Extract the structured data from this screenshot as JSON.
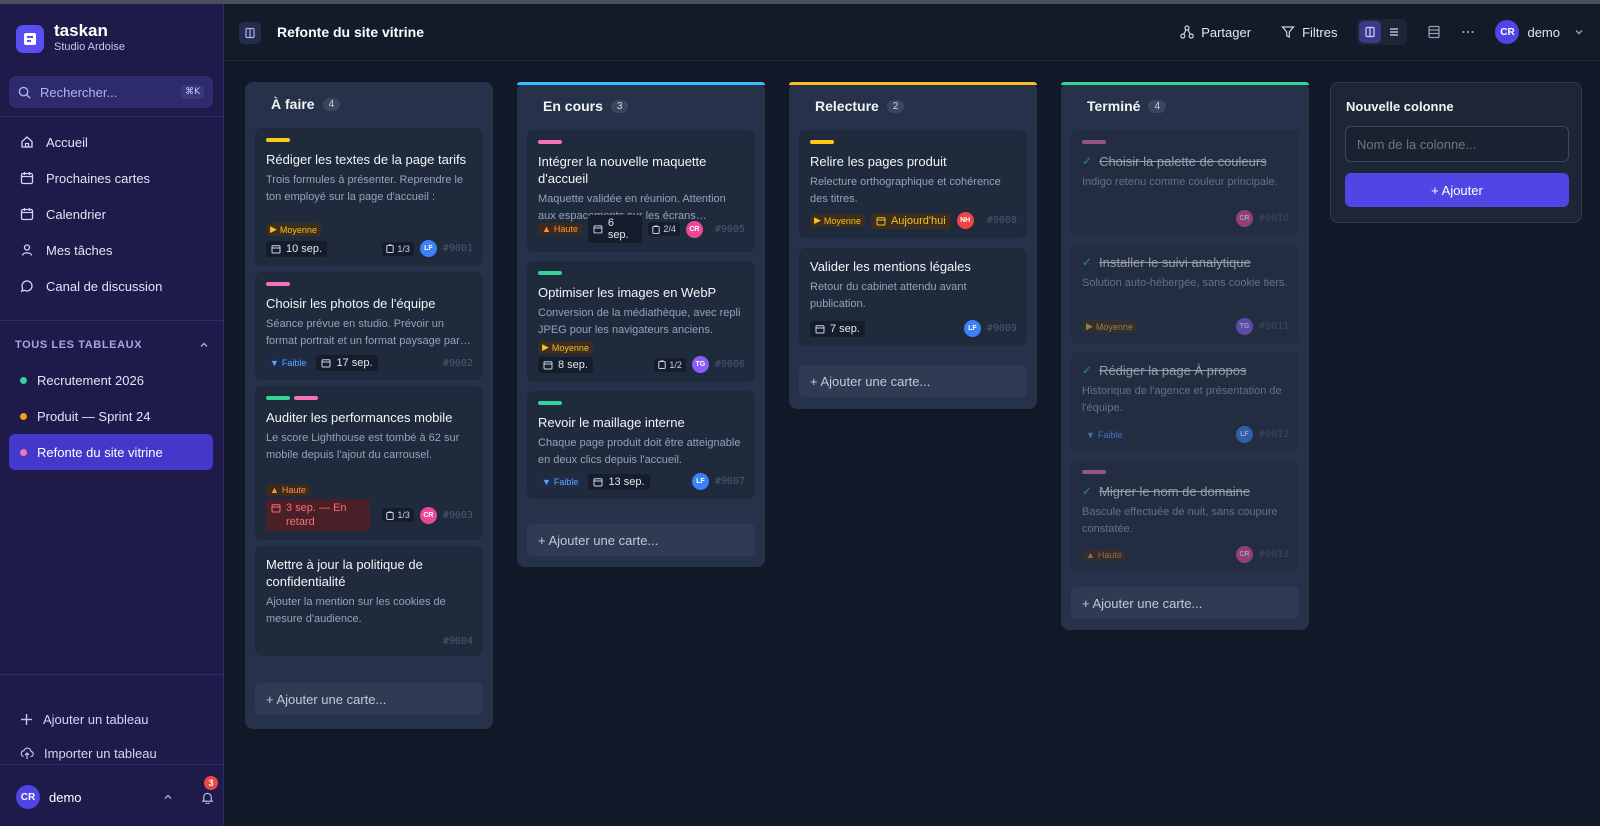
{
  "app": {
    "name": "taskan",
    "workspace": "Studio Ardoise"
  },
  "search": {
    "placeholder": "Rechercher...",
    "shortcut": "⌘K"
  },
  "nav": [
    {
      "label": "Accueil",
      "icon": "home-icon"
    },
    {
      "label": "Prochaines cartes",
      "icon": "calendar-icon"
    },
    {
      "label": "Calendrier",
      "icon": "calendar-icon"
    },
    {
      "label": "Mes tâches",
      "icon": "user-icon"
    },
    {
      "label": "Canal de discussion",
      "icon": "chat-icon"
    }
  ],
  "boards_section": {
    "title": "TOUS LES TABLEAUX"
  },
  "boards": [
    {
      "label": "Recrutement 2026",
      "color": "#34d399"
    },
    {
      "label": "Produit — Sprint 24",
      "color": "#f59e0b"
    },
    {
      "label": "Refonte du site vitrine",
      "color": "#f472b6"
    }
  ],
  "side_actions": {
    "add_board": "Ajouter un tableau",
    "import_board": "Importer un tableau"
  },
  "user": {
    "initials": "CR",
    "name": "demo",
    "notifications": "3"
  },
  "header": {
    "title": "Refonte du site vitrine",
    "share": "Partager",
    "filters": "Filtres",
    "user_initials": "CR",
    "user_name": "demo"
  },
  "columns": [
    {
      "title": "À faire",
      "count": "4",
      "accent": "",
      "add_card": "+ Ajouter une carte...",
      "cards": [
        {
          "labels": [
            "#facc15"
          ],
          "title": "Rédiger les textes de la page tarifs",
          "desc": "Trois formules à présenter. Reprendre le ton employé sur la page d'accueil : direct…",
          "priority": "Moyenne",
          "date": "10 sep.",
          "checklist": "1/3",
          "assignee": "LF",
          "id": "#9001"
        },
        {
          "labels": [
            "#f472b6"
          ],
          "title": "Choisir les photos de l'équipe",
          "desc": "Séance prévue en studio. Prévoir un format portrait et un format paysage par…",
          "priority": "Faible",
          "date": "17 sep.",
          "checklist": "",
          "assignee": "",
          "id": "#9002"
        },
        {
          "labels": [
            "#34d399",
            "#f472b6"
          ],
          "title": "Auditer les performances mobile",
          "desc": "Le score Lighthouse est tombé à 62 sur mobile depuis l'ajout du carrousel.",
          "priority": "Haute",
          "date": "3 sep. — En retard",
          "checklist": "1/3",
          "assignee": "CR",
          "id": "#9003"
        },
        {
          "labels": [],
          "title": "Mettre à jour la politique de confidentialité",
          "desc": "Ajouter la mention sur les cookies de mesure d'audience.",
          "priority": "",
          "date": "",
          "checklist": "",
          "assignee": "",
          "id": "#9004"
        }
      ]
    },
    {
      "title": "En cours",
      "count": "3",
      "accent": "#38bdf8",
      "add_card": "+ Ajouter une carte...",
      "cards": [
        {
          "labels": [
            "#f472b6"
          ],
          "title": "Intégrer la nouvelle maquette d'accueil",
          "desc": "Maquette validée en réunion. Attention aux espacements sur les écrans…",
          "priority": "Haute",
          "date": "6 sep.",
          "checklist": "2/4",
          "assignee": "CR",
          "id": "#9005"
        },
        {
          "labels": [
            "#34d399"
          ],
          "title": "Optimiser les images en WebP",
          "desc": "Conversion de la médiathèque, avec repli JPEG pour les navigateurs anciens.",
          "priority": "Moyenne",
          "date": "8 sep.",
          "checklist": "1/2",
          "assignee": "TG",
          "id": "#9006"
        },
        {
          "labels": [
            "#34d399"
          ],
          "title": "Revoir le maillage interne",
          "desc": "Chaque page produit doit être atteignable en deux clics depuis l'accueil.",
          "priority": "Faible",
          "date": "13 sep.",
          "checklist": "",
          "assignee": "LF",
          "id": "#9007"
        }
      ]
    },
    {
      "title": "Relecture",
      "count": "2",
      "accent": "#fbbf24",
      "add_card": "+ Ajouter une carte...",
      "cards": [
        {
          "labels": [
            "#facc15"
          ],
          "title": "Relire les pages produit",
          "desc": "Relecture orthographique et cohérence des titres.",
          "priority": "Moyenne",
          "date": "Aujourd'hui",
          "checklist": "",
          "assignee": "NH",
          "id": "#9008"
        },
        {
          "labels": [],
          "title": "Valider les mentions légales",
          "desc": "Retour du cabinet attendu avant publication.",
          "priority": "",
          "date": "7 sep.",
          "checklist": "",
          "assignee": "LF",
          "id": "#9009"
        }
      ]
    },
    {
      "title": "Terminé",
      "count": "4",
      "accent": "#34d399",
      "add_card": "+ Ajouter une carte...",
      "cards": [
        {
          "labels": [
            "#f472b6"
          ],
          "title": "Choisir la palette de couleurs",
          "desc": "Indigo retenu comme couleur principale.",
          "priority": "",
          "assignee": "CR",
          "id": "#9010"
        },
        {
          "labels": [],
          "title": "Installer le suivi analytique",
          "desc": "Solution auto-hébergée, sans cookie tiers.",
          "priority": "Moyenne",
          "assignee": "TG",
          "id": "#9011"
        },
        {
          "labels": [],
          "title": "Rédiger la page À propos",
          "desc": "Historique de l'agence et présentation de l'équipe.",
          "priority": "Faible",
          "assignee": "LF",
          "id": "#9012"
        },
        {
          "labels": [
            "#f472b6"
          ],
          "title": "Migrer le nom de domaine",
          "desc": "Bascule effectuée de nuit, sans coupure constatée.",
          "priority": "Haute",
          "assignee": "CR",
          "id": "#9013"
        }
      ]
    }
  ],
  "new_column": {
    "title": "Nouvelle colonne",
    "placeholder": "Nom de la colonne...",
    "button": "+ Ajouter"
  },
  "avatar_colors": {
    "LF": "#3b82f6",
    "CR": "#ec4899",
    "TG": "#8b5cf6",
    "NH": "#ef4444"
  },
  "theme": {
    "accent": "#4f46e5",
    "sidebar": "#1e1b4b",
    "canvas": "#111827"
  }
}
